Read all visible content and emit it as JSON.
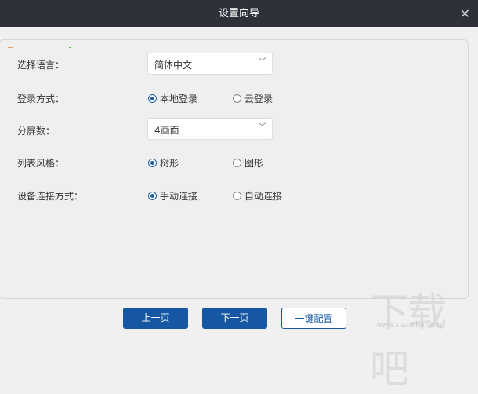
{
  "title": "设置向导",
  "close_icon": "close-icon",
  "form": {
    "language": {
      "label": "选择语言：",
      "value": "简体中文"
    },
    "login": {
      "label": "登录方式：",
      "options": [
        "本地登录",
        "云登录"
      ],
      "selected": 0
    },
    "screens": {
      "label": "分屏数：",
      "value": "4画面"
    },
    "list_style": {
      "label": "列表风格：",
      "options": [
        "树形",
        "图形"
      ],
      "selected": 0
    },
    "connect": {
      "label": "设备连接方式：",
      "options": [
        "手动连接",
        "自动连接"
      ],
      "selected": 0
    }
  },
  "buttons": {
    "prev": "上一页",
    "next": "下一页",
    "one_click": "一键配置"
  },
  "watermark": {
    "text": "下载吧",
    "url": "www.xiazaiba.com"
  }
}
